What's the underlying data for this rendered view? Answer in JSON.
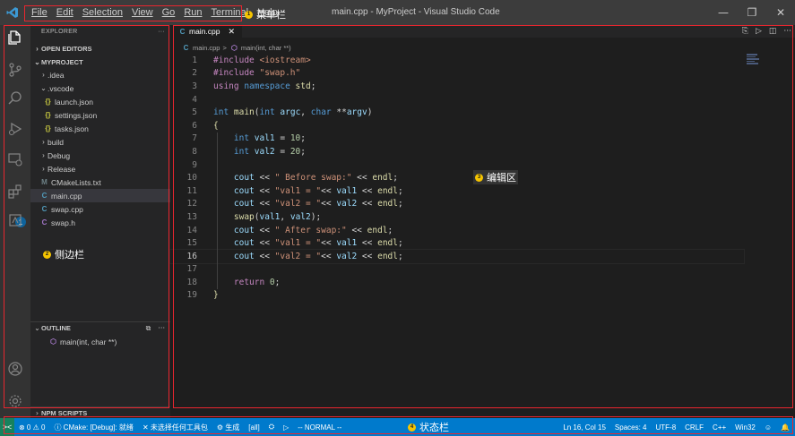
{
  "window": {
    "title": "main.cpp - MyProject - Visual Studio Code",
    "minimize": "—",
    "maximize": "❐",
    "close": "✕"
  },
  "menubar": {
    "items": [
      "File",
      "Edit",
      "Selection",
      "View",
      "Go",
      "Run",
      "Terminal",
      "Help"
    ]
  },
  "activitybar": {
    "extensions_badge": "1"
  },
  "sidebar": {
    "header": "EXPLORER",
    "header_more": "···",
    "open_editors": "OPEN EDITORS",
    "project": "MYPROJECT",
    "tree": [
      {
        "label": ".idea",
        "type": "folder",
        "depth": 1,
        "expanded": false
      },
      {
        "label": ".vscode",
        "type": "folder",
        "depth": 1,
        "expanded": true
      },
      {
        "label": "launch.json",
        "type": "json",
        "depth": 2
      },
      {
        "label": "settings.json",
        "type": "json",
        "depth": 2
      },
      {
        "label": "tasks.json",
        "type": "json",
        "depth": 2
      },
      {
        "label": "build",
        "type": "folder",
        "depth": 1,
        "expanded": false
      },
      {
        "label": "Debug",
        "type": "folder",
        "depth": 1,
        "expanded": false
      },
      {
        "label": "Release",
        "type": "folder",
        "depth": 1,
        "expanded": false
      },
      {
        "label": "CMakeLists.txt",
        "type": "cmake",
        "depth": 1
      },
      {
        "label": "main.cpp",
        "type": "cpp",
        "depth": 1,
        "active": true
      },
      {
        "label": "swap.cpp",
        "type": "cpp",
        "depth": 1
      },
      {
        "label": "swap.h",
        "type": "c",
        "depth": 1
      }
    ],
    "outline": "OUTLINE",
    "outline_more": "···",
    "outline_item": "main(int, char **)",
    "npm_scripts": "NPM SCRIPTS"
  },
  "editor": {
    "tab": "main.cpp",
    "tab_close": "✕",
    "breadcrumb_file": "main.cpp",
    "breadcrumb_sep": ">",
    "breadcrumb_symbol": "main(int, char **)",
    "current_line": 16,
    "lines": [
      [
        {
          "t": "#include ",
          "c": "pp"
        },
        {
          "t": "<iostream>",
          "c": "str"
        }
      ],
      [
        {
          "t": "#include ",
          "c": "pp"
        },
        {
          "t": "\"swap.h\"",
          "c": "str"
        }
      ],
      [
        {
          "t": "using ",
          "c": "pp"
        },
        {
          "t": "namespace ",
          "c": "kw"
        },
        {
          "t": "std",
          "c": "fn"
        },
        {
          "t": ";",
          "c": ""
        }
      ],
      [],
      [
        {
          "t": "int ",
          "c": "kw"
        },
        {
          "t": "main",
          "c": "fn"
        },
        {
          "t": "(",
          "c": ""
        },
        {
          "t": "int ",
          "c": "kw"
        },
        {
          "t": "argc",
          "c": "var"
        },
        {
          "t": ", ",
          "c": ""
        },
        {
          "t": "char ",
          "c": "kw"
        },
        {
          "t": "**",
          "c": ""
        },
        {
          "t": "argv",
          "c": "var"
        },
        {
          "t": ")",
          "c": ""
        }
      ],
      [
        {
          "t": "{",
          "c": "fn"
        }
      ],
      [
        {
          "t": "    int ",
          "c": "kw"
        },
        {
          "t": "val1",
          "c": "var"
        },
        {
          "t": " = ",
          "c": ""
        },
        {
          "t": "10",
          "c": "num"
        },
        {
          "t": ";",
          "c": ""
        }
      ],
      [
        {
          "t": "    int ",
          "c": "kw"
        },
        {
          "t": "val2",
          "c": "var"
        },
        {
          "t": " = ",
          "c": ""
        },
        {
          "t": "20",
          "c": "num"
        },
        {
          "t": ";",
          "c": ""
        }
      ],
      [],
      [
        {
          "t": "    cout",
          "c": "var"
        },
        {
          "t": " << ",
          "c": ""
        },
        {
          "t": "\" Before swap:\"",
          "c": "str"
        },
        {
          "t": " << ",
          "c": ""
        },
        {
          "t": "endl",
          "c": "fn"
        },
        {
          "t": ";",
          "c": ""
        }
      ],
      [
        {
          "t": "    cout",
          "c": "var"
        },
        {
          "t": " << ",
          "c": ""
        },
        {
          "t": "\"val1 = \"",
          "c": "str"
        },
        {
          "t": "<< ",
          "c": ""
        },
        {
          "t": "val1",
          "c": "var"
        },
        {
          "t": " << ",
          "c": ""
        },
        {
          "t": "endl",
          "c": "fn"
        },
        {
          "t": ";",
          "c": ""
        }
      ],
      [
        {
          "t": "    cout",
          "c": "var"
        },
        {
          "t": " << ",
          "c": ""
        },
        {
          "t": "\"val2 = \"",
          "c": "str"
        },
        {
          "t": "<< ",
          "c": ""
        },
        {
          "t": "val2",
          "c": "var"
        },
        {
          "t": " << ",
          "c": ""
        },
        {
          "t": "endl",
          "c": "fn"
        },
        {
          "t": ";",
          "c": ""
        }
      ],
      [
        {
          "t": "    swap",
          "c": "fn"
        },
        {
          "t": "(",
          "c": ""
        },
        {
          "t": "val1",
          "c": "var"
        },
        {
          "t": ", ",
          "c": ""
        },
        {
          "t": "val2",
          "c": "var"
        },
        {
          "t": ");",
          "c": ""
        }
      ],
      [
        {
          "t": "    cout",
          "c": "var"
        },
        {
          "t": " << ",
          "c": ""
        },
        {
          "t": "\" After swap:\"",
          "c": "str"
        },
        {
          "t": " << ",
          "c": ""
        },
        {
          "t": "endl",
          "c": "fn"
        },
        {
          "t": ";",
          "c": ""
        }
      ],
      [
        {
          "t": "    cout",
          "c": "var"
        },
        {
          "t": " << ",
          "c": ""
        },
        {
          "t": "\"val1 = \"",
          "c": "str"
        },
        {
          "t": "<< ",
          "c": ""
        },
        {
          "t": "val1",
          "c": "var"
        },
        {
          "t": " << ",
          "c": ""
        },
        {
          "t": "endl",
          "c": "fn"
        },
        {
          "t": ";",
          "c": ""
        }
      ],
      [
        {
          "t": "    cout",
          "c": "var"
        },
        {
          "t": " << ",
          "c": ""
        },
        {
          "t": "\"val2 = \"",
          "c": "str"
        },
        {
          "t": "<< ",
          "c": ""
        },
        {
          "t": "val2",
          "c": "var"
        },
        {
          "t": " << ",
          "c": ""
        },
        {
          "t": "endl",
          "c": "fn"
        },
        {
          "t": ";",
          "c": ""
        }
      ],
      [],
      [
        {
          "t": "    return ",
          "c": "pp"
        },
        {
          "t": "0",
          "c": "num"
        },
        {
          "t": ";",
          "c": ""
        }
      ],
      [
        {
          "t": "}",
          "c": "fn"
        }
      ]
    ]
  },
  "statusbar": {
    "remote": "><",
    "problems": "⊗ 0 ⚠ 0",
    "cmake": "ⓘ CMake: [Debug]: 就绪",
    "kit": "✕ 未选择任何工具包",
    "build": "⚙ 生成",
    "target": "[all]",
    "debug": "⛭",
    "run": "▷",
    "mode": "-- NORMAL --",
    "position": "Ln 16, Col 15",
    "spaces": "Spaces: 4",
    "encoding": "UTF-8",
    "eol": "CRLF",
    "language": "C++",
    "platform": "Win32",
    "feedback": "☺",
    "notifications": "🔔"
  },
  "annotations": {
    "menu": {
      "num": "1",
      "label": "菜单栏"
    },
    "sidebar": {
      "num": "2",
      "label": "侧边栏"
    },
    "editor": {
      "num": "3",
      "label": "编辑区"
    },
    "status": {
      "num": "4",
      "label": "状态栏"
    }
  },
  "colors": {
    "accent": "#007acc",
    "annotation_box": "#e8262f",
    "annotation_dot": "#f5c400"
  }
}
